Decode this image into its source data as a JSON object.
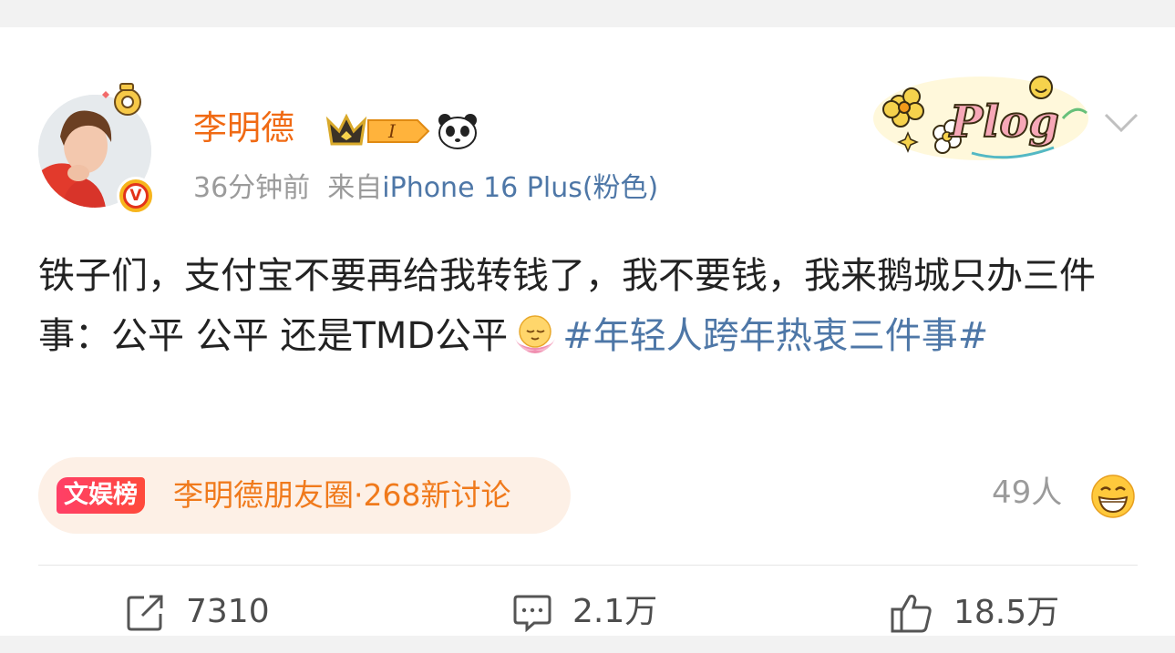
{
  "post": {
    "author": "李明德",
    "time": "36分钟前",
    "source_prefix": "来自",
    "device": "iPhone 16 Plus(粉色)",
    "level_badge": "I",
    "sticker_text": "Plog",
    "body_main": "铁子们，支付宝不要再给我转钱了，我不要钱，我来鹅城只办三件事：公平 公平 还是TMD公平",
    "hashtag": "#年轻人跨年热衷三件事#"
  },
  "topic": {
    "badge": "文娱榜",
    "text": "李明德朋友圈·268新讨论"
  },
  "reactions": {
    "count_text": "49人"
  },
  "actions": {
    "repost": "7310",
    "comment": "2.1万",
    "like": "18.5万"
  },
  "icons": [
    "avatar",
    "verified-v-icon",
    "crown-badge-icon",
    "panda-icon",
    "plog-sticker",
    "chevron-down-icon",
    "lotus-emoji-icon",
    "grin-emoji-icon",
    "repost-icon",
    "comment-icon",
    "like-icon"
  ],
  "colors": {
    "username": "#f06a14",
    "link": "#4e77a7",
    "meta": "#9b9b9b",
    "topic_bg": "#fdf0e6",
    "topic_text": "#f07a1c"
  }
}
